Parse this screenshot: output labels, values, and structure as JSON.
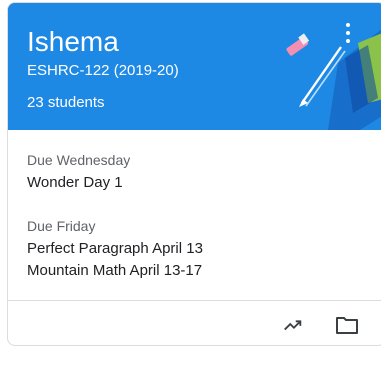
{
  "class_card": {
    "title": "Ishema",
    "section": "ESHRC-122 (2019-20)",
    "students": "23 students",
    "header_color": "#1e88e5",
    "more_icon": "more-vert-icon"
  },
  "due": [
    {
      "label": "Due Wednesday",
      "items": [
        "Wonder Day 1"
      ]
    },
    {
      "label": "Due Friday",
      "items": [
        "Perfect Paragraph April 13",
        "Mountain Math April 13-17"
      ]
    }
  ],
  "footer": {
    "icons": [
      "trending-up-icon",
      "folder-icon"
    ]
  }
}
